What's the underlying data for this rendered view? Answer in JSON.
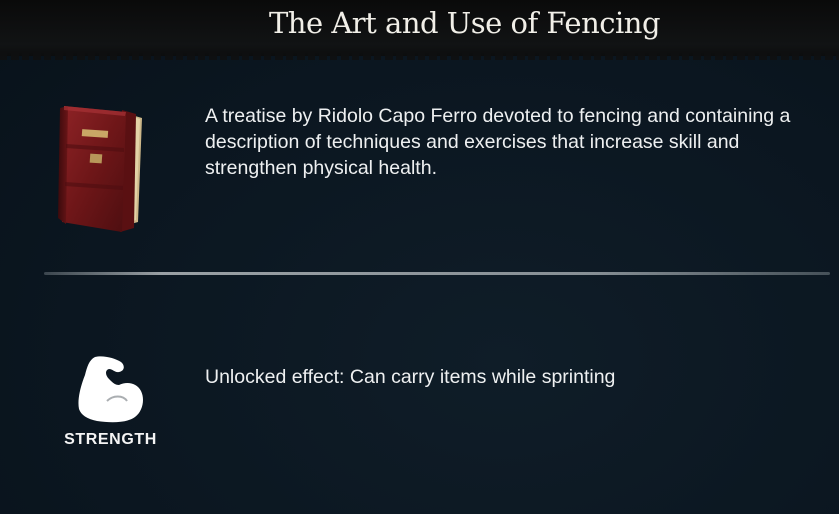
{
  "header": {
    "title": "The Art and Use of Fencing"
  },
  "item": {
    "icon": "red-book-icon",
    "description": "A treatise by Ridolo Capo Ferro devoted to fencing and containing a description of techniques and exercises that increase skill and strengthen physical health."
  },
  "effect": {
    "stat_icon": "flexed-arm-icon",
    "stat_label": "STRENGTH",
    "text": "Unlocked effect: Can carry items while sprinting"
  },
  "colors": {
    "background": "#0b1620",
    "header": "#111314",
    "text": "#eef0f1",
    "book_red": "#7a1a1c"
  }
}
